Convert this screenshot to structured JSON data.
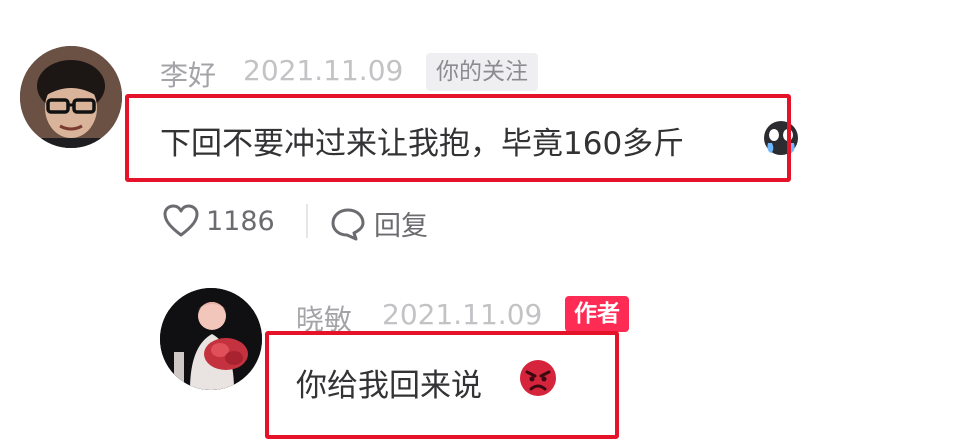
{
  "comment": {
    "user_name": "李好",
    "timestamp": "2021.11.09",
    "follow_badge": "你的关注",
    "text": "下回不要冲过来让我抱，毕竟160多斤",
    "emoji_icon": "crying-face-emoji",
    "like_count": "1186",
    "reply_label": "回复"
  },
  "reply": {
    "user_name": "晓敏",
    "timestamp": "2021.11.09",
    "author_badge": "作者",
    "text": "你给我回来说",
    "emoji_icon": "angry-face-emoji"
  },
  "colors": {
    "highlight_border": "#e5132a",
    "author_badge": "#fe2c55",
    "angry_emoji": "#d6243c"
  }
}
